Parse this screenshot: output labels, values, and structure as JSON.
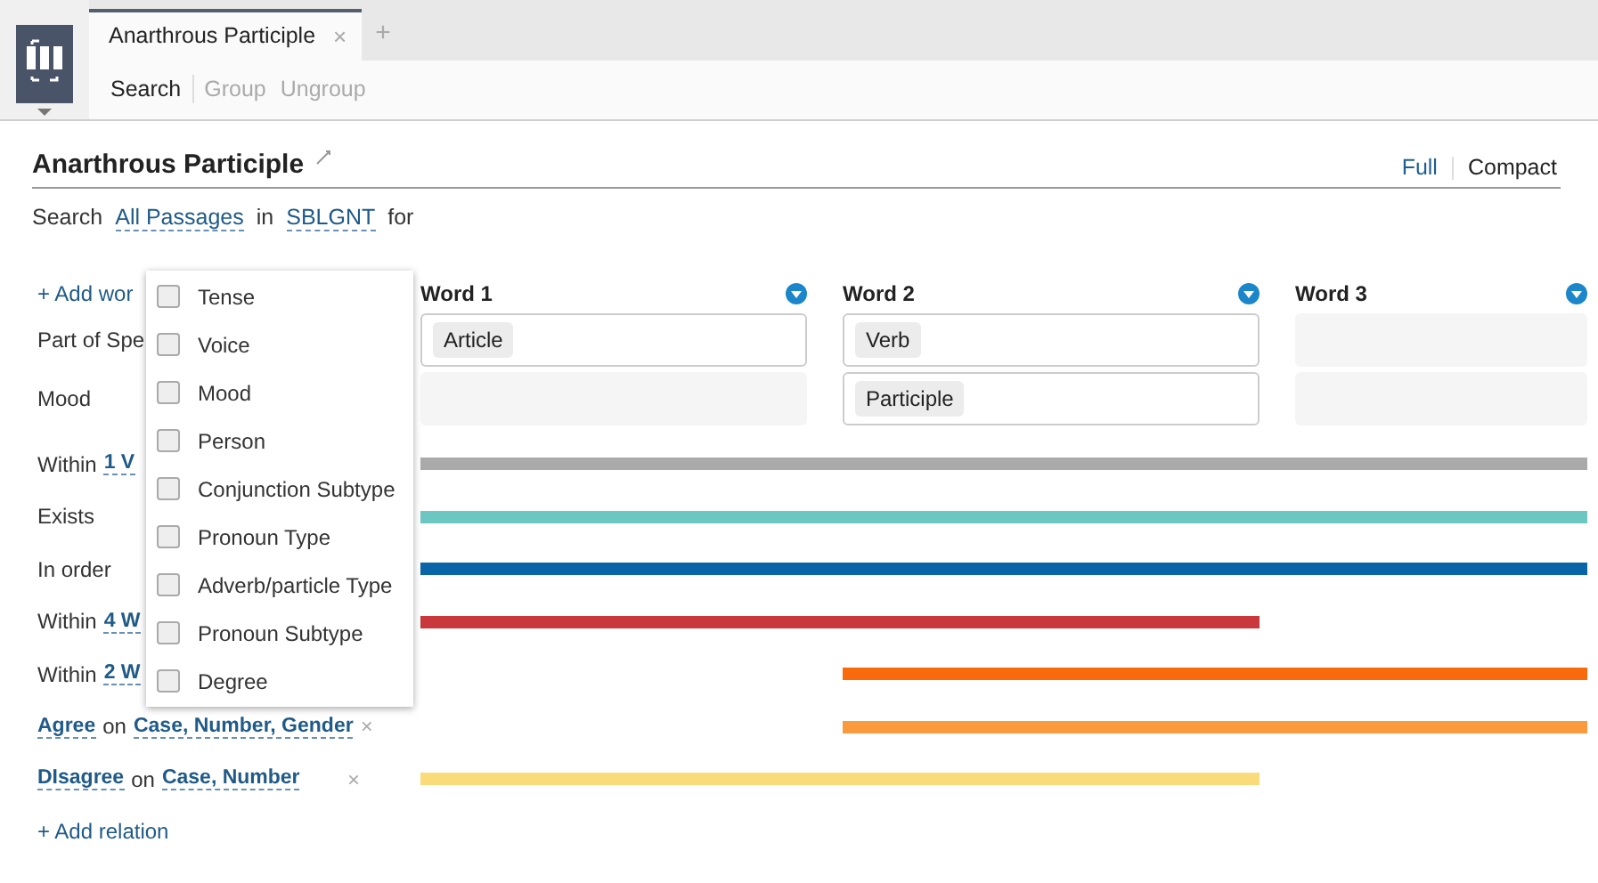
{
  "tabs": [
    {
      "label": "Anarthrous Participle",
      "selected": true,
      "close": "×"
    }
  ],
  "new_tab": "+",
  "toolbar": [
    {
      "label": "Search",
      "disabled": false
    },
    {
      "label": "Group",
      "disabled": true
    },
    {
      "label": "Ungroup",
      "disabled": true
    }
  ],
  "query": {
    "title": "Anarthrous Participle",
    "views": [
      {
        "label": "Full",
        "selected": false
      },
      {
        "label": "Compact",
        "selected": true
      }
    ],
    "search_line": [
      {
        "kind": "plain",
        "text": "Search"
      },
      {
        "kind": "link",
        "text": "All Passages"
      },
      {
        "kind": "plain",
        "text": "in"
      },
      {
        "kind": "link",
        "text": "SBLGNT"
      },
      {
        "kind": "plain",
        "text": "for"
      }
    ]
  },
  "add_word": "+ Add wor",
  "words": [
    {
      "label": "Word 1",
      "cells": [
        {
          "kind": "field",
          "tag": "Article"
        },
        {
          "kind": "empty"
        }
      ]
    },
    {
      "label": "Word 2",
      "cells": [
        {
          "kind": "field",
          "tag": "Verb"
        },
        {
          "kind": "field",
          "tag": "Participle"
        }
      ]
    },
    {
      "label": "Word 3",
      "cells": [
        {
          "kind": "empty"
        },
        {
          "kind": "empty"
        }
      ]
    }
  ],
  "attributes": [
    "Part of Spe",
    "Mood"
  ],
  "relations": [
    {
      "parts": [
        {
          "kind": "plain",
          "text": "Within"
        },
        {
          "kind": "link",
          "text": "1 V"
        }
      ],
      "removable": false,
      "color": "#aaaaaa",
      "kind": "full"
    },
    {
      "parts": [
        {
          "kind": "plain",
          "text": "Exists"
        }
      ],
      "removable": false,
      "color": "#6cc7c3",
      "kind": "full"
    },
    {
      "parts": [
        {
          "kind": "plain",
          "text": "In order"
        }
      ],
      "removable": false,
      "color": "#0a64a8",
      "kind": "full"
    },
    {
      "parts": [
        {
          "kind": "plain",
          "text": "Within"
        },
        {
          "kind": "link",
          "text": "4 W"
        }
      ],
      "removable": false,
      "color": "#c9383a",
      "kind": "leading"
    },
    {
      "parts": [
        {
          "kind": "plain",
          "text": "Within"
        },
        {
          "kind": "link",
          "text": "2 W"
        }
      ],
      "removable": false,
      "color": "#f86a0c",
      "kind": "trailing"
    },
    {
      "parts": [
        {
          "kind": "link",
          "text": "Agree"
        },
        {
          "kind": "plain",
          "text": "on"
        },
        {
          "kind": "link",
          "text": "Case, Number, Gender"
        }
      ],
      "removable": true,
      "color": "#fb9a3c",
      "kind": "trailing"
    },
    {
      "parts": [
        {
          "kind": "link",
          "text": "DIsagree"
        },
        {
          "kind": "plain",
          "text": "on"
        },
        {
          "kind": "link",
          "text": "Case, Number"
        }
      ],
      "removable": true,
      "color": "#fadb7a",
      "kind": "leading"
    }
  ],
  "remove_mark": "×",
  "add_relation": "+ Add relation",
  "menu": [
    {
      "label": "Tense",
      "checked": false
    },
    {
      "label": "Voice",
      "checked": false
    },
    {
      "label": "Mood",
      "checked": false
    },
    {
      "label": "Person",
      "checked": false
    },
    {
      "label": "Conjunction Subtype",
      "checked": false
    },
    {
      "label": "Pronoun Type",
      "checked": false
    },
    {
      "label": "Adverb/particle Type",
      "checked": false
    },
    {
      "label": "Pronoun Subtype",
      "checked": false
    },
    {
      "label": "Degree",
      "checked": false
    }
  ]
}
